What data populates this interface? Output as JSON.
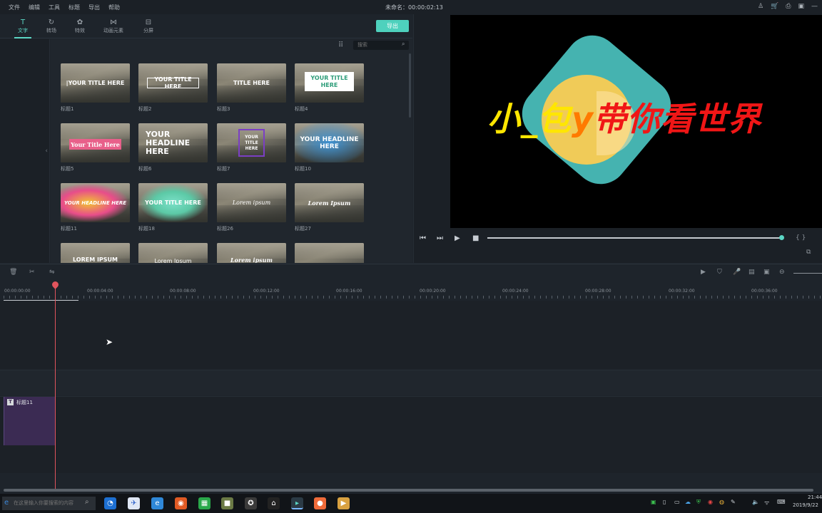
{
  "menu": [
    "文件",
    "编辑",
    "工具",
    "标题",
    "导出",
    "帮助"
  ],
  "project_title": "未命名：00:00:02:13",
  "window_icons": [
    "♙",
    "🛒",
    "⎙",
    "▣",
    "—"
  ],
  "tabs": [
    {
      "icon": "T",
      "label": "文字"
    },
    {
      "icon": "↻",
      "label": "转场"
    },
    {
      "icon": "✿",
      "label": "特效"
    },
    {
      "icon": "⋈",
      "label": "动画元素"
    },
    {
      "icon": "⊟",
      "label": "分屏"
    }
  ],
  "export_label": "导出",
  "search_placeholder": "搜索",
  "thumbnails": [
    {
      "caption": "|YOUR TITLE HERE",
      "label": "标题1"
    },
    {
      "caption": "YOUR TITLE HERE",
      "label": "标题2"
    },
    {
      "caption": "TITLE HERE",
      "label": "标题3"
    },
    {
      "caption": "YOUR TITLE HERE",
      "label": "标题4"
    },
    {
      "caption": "Your Title Here",
      "label": "标题5"
    },
    {
      "caption": "YOUR HEADLINE HERE",
      "label": "标题6"
    },
    {
      "caption": "YOUR TITLE HERE",
      "label": "标题7"
    },
    {
      "caption": "YOUR HEADLINE HERE",
      "label": "标题10"
    },
    {
      "caption": "YOUR HEADLINE HERE",
      "label": "标题11"
    },
    {
      "caption": "YOUR TITLE HERE",
      "label": "标题18"
    },
    {
      "caption": "Lorem ipsum",
      "label": "标题26"
    },
    {
      "caption": "Lorem Ipsum",
      "label": "标题27"
    },
    {
      "caption": "LOREM IPSUM",
      "label": ""
    },
    {
      "caption": "Lorem Ipsum",
      "label": ""
    },
    {
      "caption": "Lorem ipsum",
      "label": ""
    },
    {
      "caption": "",
      "label": ""
    }
  ],
  "preview": {
    "part1": "小_包",
    "part2": "y",
    "part3": "带你看世界"
  },
  "player_controls": [
    "⏮",
    "⏭",
    "▶",
    "■"
  ],
  "brackets": "{ }",
  "ruler_labels": [
    "00:00:00:00",
    "00:00:04:00",
    "00:00:08:00",
    "00:00:12:00",
    "00:00:16:00",
    "00:00:20:00",
    "00:00:24:00",
    "00:00:28:00",
    "00:00:32:00",
    "00:00:36:00"
  ],
  "clip_label": "标题11",
  "taskbar": {
    "search_placeholder": "在这里输入你要搜索的内容",
    "clock_time": "21:44",
    "clock_date": "2019/9/22"
  }
}
